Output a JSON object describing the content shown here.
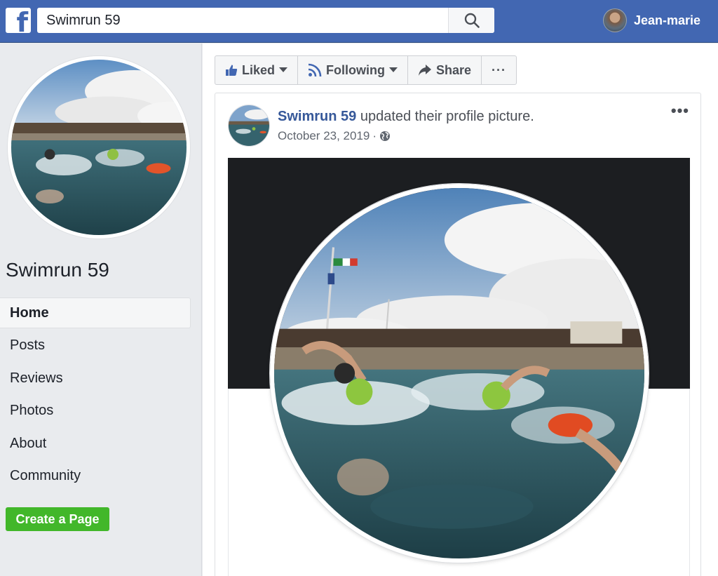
{
  "topbar": {
    "logo": "facebook-logo",
    "search_value": "Swimrun 59",
    "search_placeholder": "Search",
    "user_name": "Jean-marie"
  },
  "sidebar": {
    "page_name": "Swimrun 59",
    "items": [
      {
        "label": "Home",
        "active": true
      },
      {
        "label": "Posts"
      },
      {
        "label": "Reviews"
      },
      {
        "label": "Photos"
      },
      {
        "label": "About"
      },
      {
        "label": "Community"
      }
    ],
    "create_page_label": "Create a Page"
  },
  "actions": {
    "liked_label": "Liked",
    "following_label": "Following",
    "share_label": "Share",
    "more_label": "···"
  },
  "post": {
    "author": "Swimrun 59",
    "action_text": " updated their profile picture.",
    "date": "October 23, 2019",
    "separator": "·",
    "more": "•••",
    "audience_icon": "globe-icon"
  },
  "colors": {
    "brand_blue": "#4267b2",
    "link_blue": "#365899",
    "create_green": "#42b72a",
    "cover_dark": "#1c1e21"
  }
}
